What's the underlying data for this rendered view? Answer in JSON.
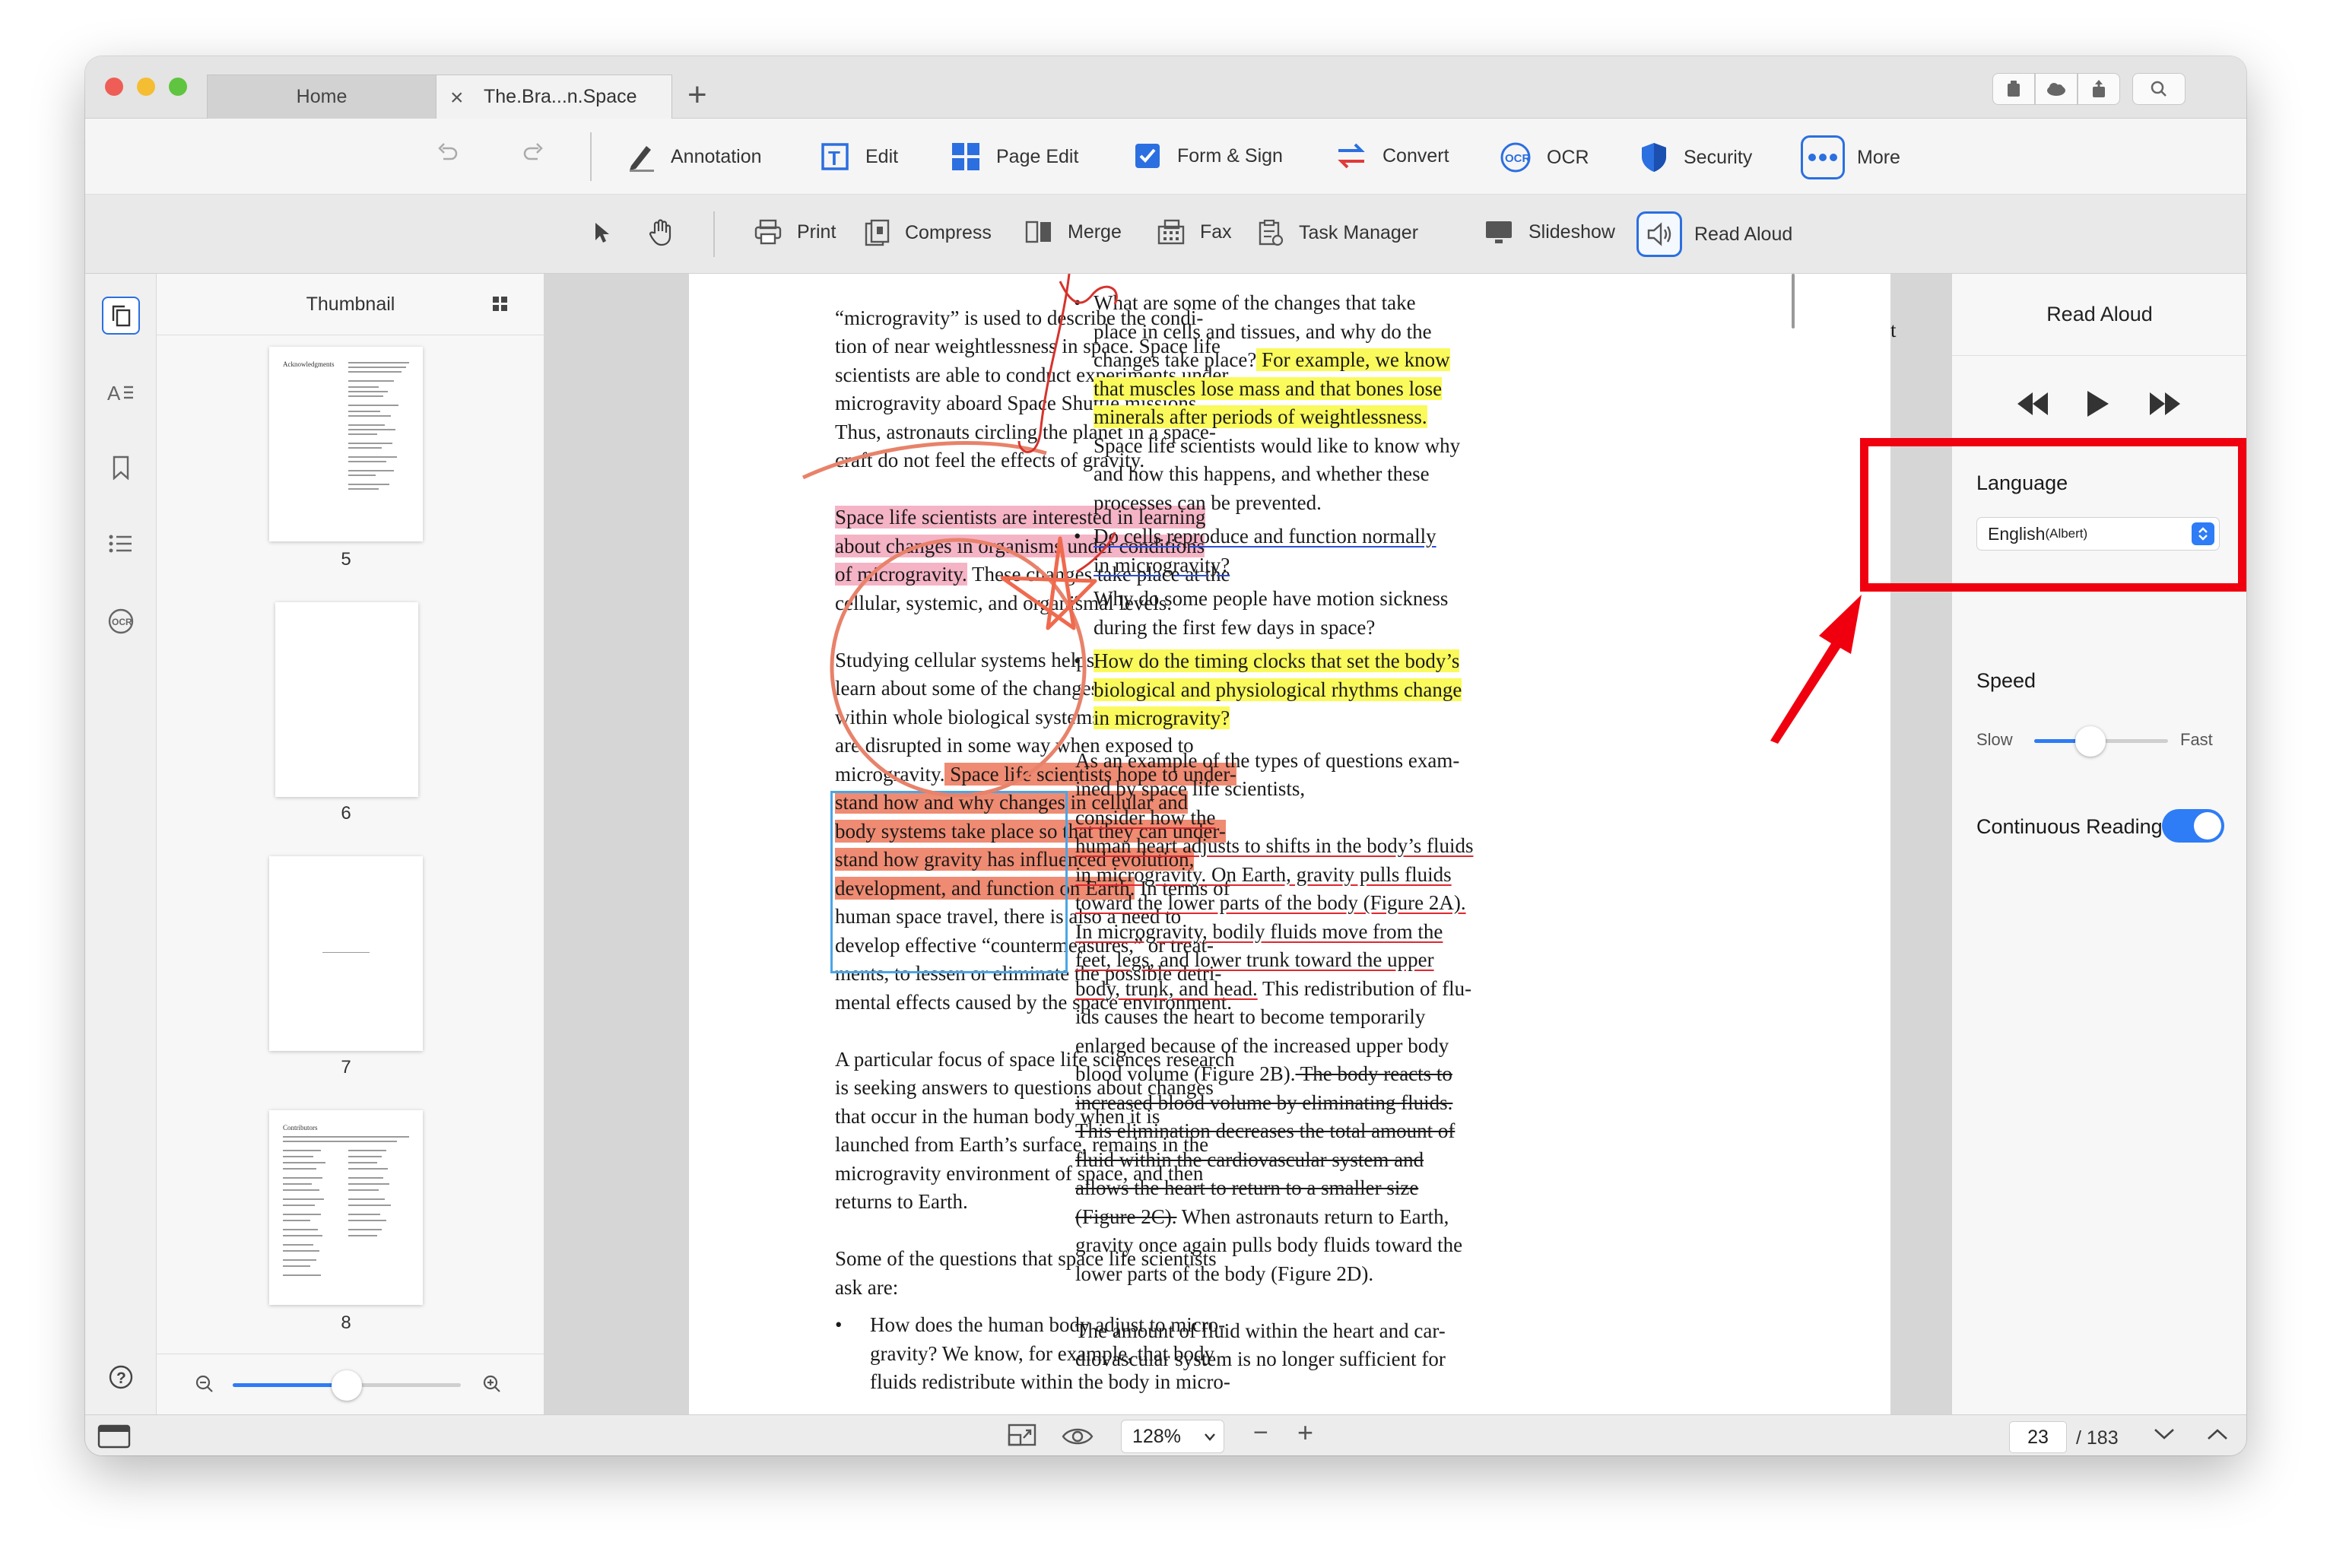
{
  "tabs": {
    "home": "Home",
    "doc": "The.Bra...n.Space",
    "close_glyph": "×",
    "add_glyph": "+"
  },
  "toolbar1": [
    {
      "label": "Annotation",
      "icon": "pen-icon"
    },
    {
      "label": "Edit",
      "icon": "edit-text-icon"
    },
    {
      "label": "Page Edit",
      "icon": "grid-icon"
    },
    {
      "label": "Form & Sign",
      "icon": "checkbox-icon"
    },
    {
      "label": "Convert",
      "icon": "convert-icon"
    },
    {
      "label": "OCR",
      "icon": "ocr-icon"
    },
    {
      "label": "Security",
      "icon": "shield-icon"
    },
    {
      "label": "More",
      "icon": "more-icon"
    }
  ],
  "toolbar2": [
    {
      "label": "Print",
      "icon": "printer-icon"
    },
    {
      "label": "Compress",
      "icon": "compress-icon"
    },
    {
      "label": "Merge",
      "icon": "merge-icon"
    },
    {
      "label": "Fax",
      "icon": "fax-icon"
    },
    {
      "label": "Task Manager",
      "icon": "task-icon"
    },
    {
      "label": "Slideshow",
      "icon": "monitor-icon"
    },
    {
      "label": "Read Aloud",
      "icon": "speaker-icon"
    }
  ],
  "thumbnail": {
    "title": "Thumbnail",
    "pages": [
      "5",
      "6",
      "7",
      "8"
    ],
    "p5_heading": "Acknowledgments",
    "p8_heading": "Contributors",
    "zoom_level": 0.5
  },
  "doc": {
    "left": {
      "p1": [
        "“microgravity” is used to describe the condi-",
        "tion of near weightlessness in space. Space life",
        "scientists are able to conduct experiments under",
        "microgravity aboard Space Shuttle missions.",
        "Thus, astronauts circling the planet in a space-",
        "craft do not feel the effects of gravity."
      ],
      "p2_hl": [
        "Space life scientists are interested in learning",
        "about changes in organisms under conditions",
        "of microgravity."
      ],
      "p2_rest": [
        " These changes take place at the",
        "cellular, systemic, and organismal levels."
      ],
      "p3": [
        "Studying cellular systems helps scientists to",
        "learn about some of the changes that occur",
        "within whole biological systems in space. Most",
        "are disrupted in some way when exposed to",
        "microgravity."
      ],
      "p3_hl": [
        " Space life scientists hope to under-",
        "stand how and why changes in cellular and",
        "body systems take place so that they can under-",
        "stand how gravity has influenced evolution,",
        "development, and function on Earth."
      ],
      "p3_rest": [
        " In terms of",
        "human space travel, there is also a need to",
        "develop effective “countermeasures,” or treat-",
        "ments, to lessen or eliminate the possible detri-",
        "mental effects caused by the space environment."
      ],
      "p4": [
        "A particular focus of space life sciences research",
        "is seeking answers to questions about changes",
        "that occur in the human body when it is",
        "launched from Earth’s surface, remains in the",
        "microgravity environment of space, and then",
        "returns to Earth."
      ],
      "p5": [
        "Some of the questions that space life scientists",
        "ask are:"
      ],
      "bullet1": [
        "How does the human body adjust to micro-",
        "gravity? We know, for example, that body",
        "fluids redistribute within the body in micro-"
      ]
    },
    "right": {
      "b1": [
        "What are some of the changes that take",
        "place in cells and tissues, and why do the",
        "changes take place?"
      ],
      "b1_hl": [
        " For example, we know",
        "that muscles lose mass and that bones lose",
        "minerals after periods of weightlessness."
      ],
      "b1_rest": [
        "Space life scientists would like to know why",
        "and how this happens, and whether these",
        "processes can be prevented."
      ],
      "b2": [
        "Do cells reproduce and function normally",
        "in microgravity?"
      ],
      "b3": [
        "Why do some people have motion sickness",
        "during the first few days in space?"
      ],
      "b4": [
        "How do the timing clocks that set the body’s",
        "biological and physiological rhythms change",
        "in microgravity?"
      ],
      "p1_plain": [
        "As an example of the types of questions exam-",
        "ined by space life scientists, "
      ],
      "p1_red": [
        "consider how the",
        "human heart adjusts to shifts in the body’s fluids",
        "in microgravity. On Earth, gravity pulls fluids",
        "toward the lower parts of the body (Figure 2A).",
        "In microgravity, bodily fluids move from the",
        "feet, legs, and lower trunk toward the upper",
        "body, trunk, and head."
      ],
      "p1_mid": [
        " This redistribution of flu-",
        "ids causes the heart to become temporarily",
        "enlarged because of the increased upper body",
        "blood volume (Figure 2B)."
      ],
      "p1_strike": [
        " The body reacts to",
        "increased blood volume by eliminating fluids.",
        "This elimination decreases the total amount of",
        "fluid within the cardiovascular system and",
        "allows the heart to return to a smaller size",
        "(Figure 2C)."
      ],
      "p1_end": [
        " When astronauts return to Earth,",
        "gravity once again pulls body fluids toward the",
        "lower parts of the body (Figure 2D)."
      ],
      "p2": [
        "The amount of fluid within the heart and car-",
        "diovascular system is no longer sufficient for"
      ],
      "edge_char": "t"
    }
  },
  "read_aloud": {
    "title": "Read Aloud",
    "language_label": "Language",
    "language_value": "English",
    "language_voice": "(Albert)",
    "speed_label": "Speed",
    "speed_slow": "Slow",
    "speed_fast": "Fast",
    "speed_value": 0.42,
    "continuous_label": "Continuous Reading",
    "continuous_on": true
  },
  "status": {
    "zoom": "128%",
    "page_current": "23",
    "page_total": "/ 183",
    "minus": "−",
    "plus": "+"
  },
  "colors": {
    "accent": "#2e7cf6",
    "highlight_box": "#f0000f",
    "pen_red": "#e0272d",
    "circle": "#e8826a"
  }
}
